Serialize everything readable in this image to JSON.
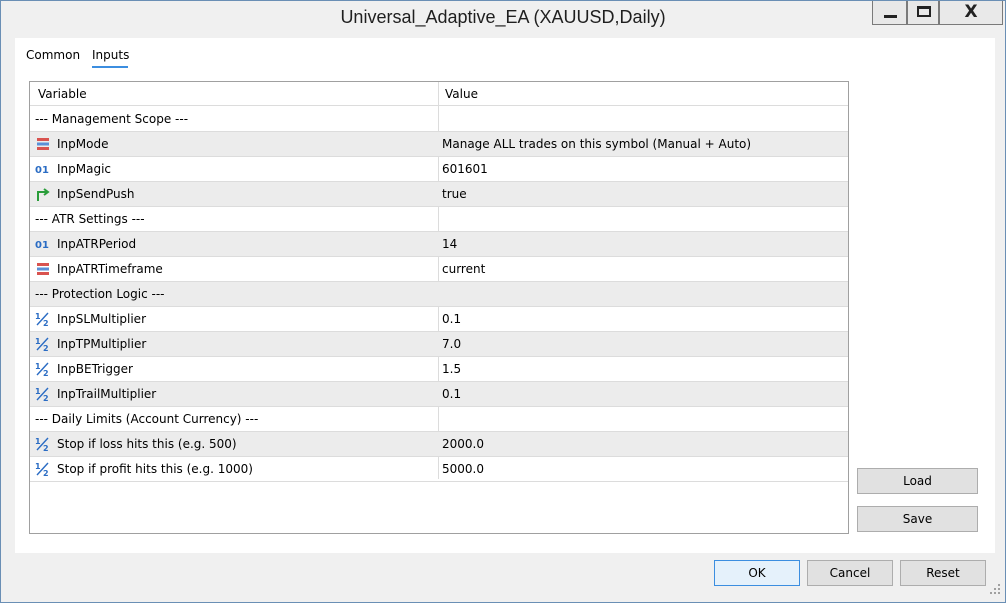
{
  "window": {
    "title": "Universal_Adaptive_EA (XAUUSD,Daily)",
    "controls": {
      "close_glyph": "X"
    }
  },
  "tabs": [
    {
      "label": "Common",
      "active": false
    },
    {
      "label": "Inputs",
      "active": true
    }
  ],
  "table": {
    "headers": {
      "variable": "Variable",
      "value": "Value"
    },
    "rows": [
      {
        "variable": "--- Management Scope ---",
        "value": "",
        "icon": "",
        "alt": false
      },
      {
        "variable": "InpMode",
        "value": "Manage ALL trades on this symbol (Manual + Auto)",
        "icon": "enum-icon",
        "alt": true
      },
      {
        "variable": "InpMagic",
        "value": "601601",
        "icon": "integer-icon",
        "alt": false
      },
      {
        "variable": "InpSendPush",
        "value": "true",
        "icon": "boolean-icon",
        "alt": true
      },
      {
        "variable": "--- ATR Settings ---",
        "value": "",
        "icon": "",
        "alt": false
      },
      {
        "variable": "InpATRPeriod",
        "value": "14",
        "icon": "integer-icon",
        "alt": true
      },
      {
        "variable": "InpATRTimeframe",
        "value": "current",
        "icon": "enum-icon",
        "alt": false
      },
      {
        "variable": "--- Protection Logic ---",
        "value": "",
        "icon": "",
        "alt": true
      },
      {
        "variable": "InpSLMultiplier",
        "value": "0.1",
        "icon": "double-icon",
        "alt": false
      },
      {
        "variable": "InpTPMultiplier",
        "value": "7.0",
        "icon": "double-icon",
        "alt": true
      },
      {
        "variable": "InpBETrigger",
        "value": "1.5",
        "icon": "double-icon",
        "alt": false
      },
      {
        "variable": "InpTrailMultiplier",
        "value": "0.1",
        "icon": "double-icon",
        "alt": true
      },
      {
        "variable": "--- Daily Limits (Account Currency) ---",
        "value": "",
        "icon": "",
        "alt": false
      },
      {
        "variable": "Stop if loss hits this (e.g. 500)",
        "value": "2000.0",
        "icon": "double-icon",
        "alt": true
      },
      {
        "variable": "Stop if profit hits this (e.g. 1000)",
        "value": "5000.0",
        "icon": "double-icon",
        "alt": false
      }
    ]
  },
  "side_buttons": {
    "load": "Load",
    "save": "Save"
  },
  "footer_buttons": {
    "ok": "OK",
    "cancel": "Cancel",
    "reset": "Reset"
  },
  "colors": {
    "accent": "#3c8ee0",
    "row_alt": "#ececec",
    "border": "#a0a0a0"
  }
}
